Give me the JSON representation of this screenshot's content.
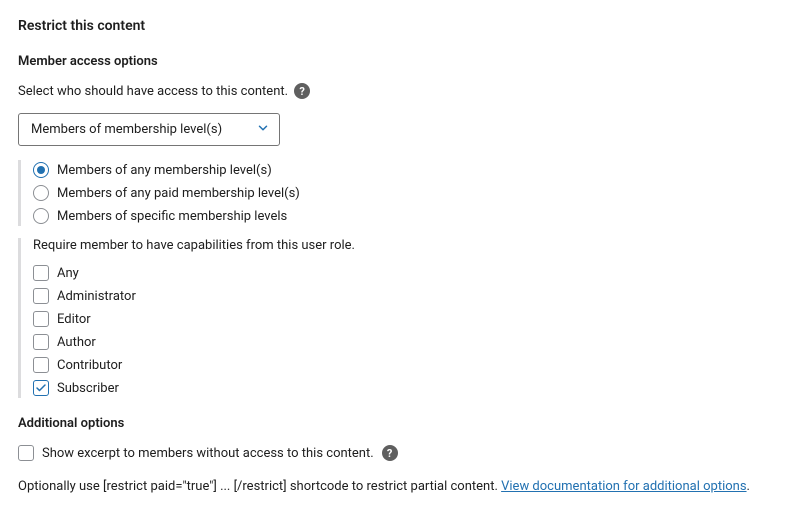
{
  "title": "Restrict this content",
  "memberAccess": {
    "heading": "Member access options",
    "helper": "Select who should have access to this content.",
    "selectValue": "Members of membership level(s)",
    "radios": [
      {
        "label": "Members of any membership level(s)",
        "selected": true
      },
      {
        "label": "Members of any paid membership level(s)",
        "selected": false
      },
      {
        "label": "Members of specific membership levels",
        "selected": false
      }
    ],
    "roleHeading": "Require member to have capabilities from this user role.",
    "roles": [
      {
        "label": "Any",
        "checked": false
      },
      {
        "label": "Administrator",
        "checked": false
      },
      {
        "label": "Editor",
        "checked": false
      },
      {
        "label": "Author",
        "checked": false
      },
      {
        "label": "Contributor",
        "checked": false
      },
      {
        "label": "Subscriber",
        "checked": true
      }
    ]
  },
  "additional": {
    "heading": "Additional options",
    "excerptLabel": "Show excerpt to members without access to this content.",
    "excerptChecked": false,
    "bottomPrefix": "Optionally use [restrict paid=\"true\"] ... [/restrict] shortcode to restrict partial content. ",
    "linkText": "View documentation for additional options",
    "bottomSuffix": "."
  }
}
